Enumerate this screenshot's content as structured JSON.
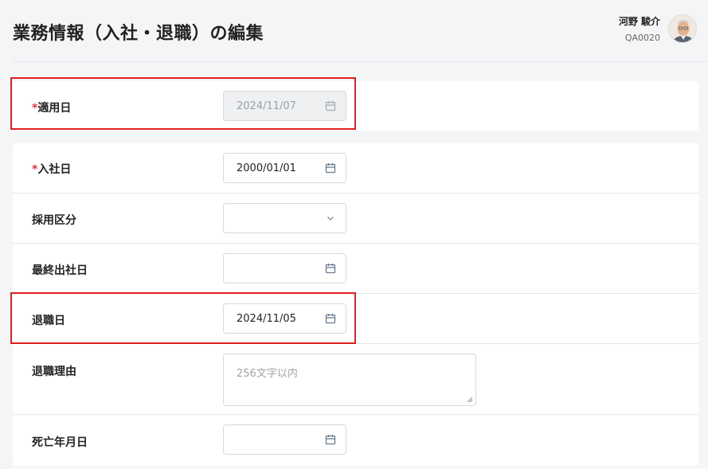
{
  "page": {
    "title": "業務情報（入社・退職）の編集"
  },
  "user": {
    "name": "河野 駿介",
    "code": "QA0020"
  },
  "fields": {
    "apply_date": {
      "required_mark": "*",
      "label": "適用日",
      "value": "2024/11/07"
    },
    "hire_date": {
      "required_mark": "*",
      "label": "入社日",
      "value": "2000/01/01"
    },
    "hire_type": {
      "label": "採用区分",
      "value": ""
    },
    "last_work_date": {
      "label": "最終出社日",
      "value": ""
    },
    "retire_date": {
      "label": "退職日",
      "value": "2024/11/05"
    },
    "retire_reason": {
      "label": "退職理由",
      "placeholder": "256文字以内"
    },
    "death_date": {
      "label": "死亡年月日",
      "value": ""
    }
  },
  "icons": {
    "calendar": "calendar-icon",
    "chevron": "chevron-down-icon"
  },
  "colors": {
    "highlight": "#e01e1e",
    "required": "#d9363e"
  }
}
